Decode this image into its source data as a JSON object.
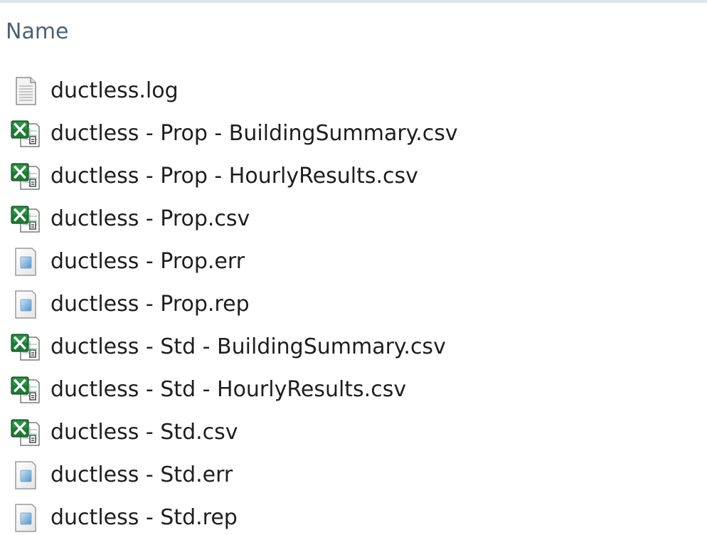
{
  "header": {
    "name_label": "Name"
  },
  "files": [
    {
      "name": "ductless.log",
      "icon": "text-document-icon"
    },
    {
      "name": "ductless - Prop - BuildingSummary.csv",
      "icon": "excel-csv-icon"
    },
    {
      "name": "ductless - Prop - HourlyResults.csv",
      "icon": "excel-csv-icon"
    },
    {
      "name": "ductless - Prop.csv",
      "icon": "excel-csv-icon"
    },
    {
      "name": "ductless - Prop.err",
      "icon": "generic-file-icon"
    },
    {
      "name": "ductless - Prop.rep",
      "icon": "generic-file-icon"
    },
    {
      "name": "ductless - Std - BuildingSummary.csv",
      "icon": "excel-csv-icon"
    },
    {
      "name": "ductless - Std - HourlyResults.csv",
      "icon": "excel-csv-icon"
    },
    {
      "name": "ductless - Std.csv",
      "icon": "excel-csv-icon"
    },
    {
      "name": "ductless - Std.err",
      "icon": "generic-file-icon"
    },
    {
      "name": "ductless - Std.rep",
      "icon": "generic-file-icon"
    }
  ],
  "colors": {
    "header_text": "#4c607a",
    "file_text": "#1e1e1e",
    "excel_green": "#1e7a35"
  }
}
